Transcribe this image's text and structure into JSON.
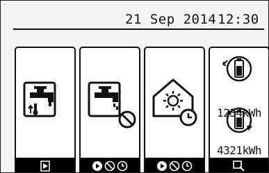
{
  "status_bar": {
    "date": "21 Sep 2014",
    "time": "12:30"
  },
  "tiles": [
    {
      "name": "Hot water",
      "bar_icons": [
        "play-icon"
      ]
    },
    {
      "name": "Stop hot water",
      "bar_icons": [
        "play-icon",
        "prohibit-icon",
        "clock-icon"
      ]
    },
    {
      "name": "Heating",
      "bar_icons": [
        "play-icon",
        "prohibit-icon",
        "clock-icon"
      ]
    },
    {
      "name": "Energy",
      "bar_icons": [
        "magnifier-icon"
      ]
    }
  ],
  "energy": {
    "consumed_value": "1234kWh",
    "delivered_value": "4321kWh"
  },
  "colors": {
    "background": "#f4f4f4",
    "tile": "#ffffff",
    "ink": "#111111",
    "bar": "#000000"
  }
}
